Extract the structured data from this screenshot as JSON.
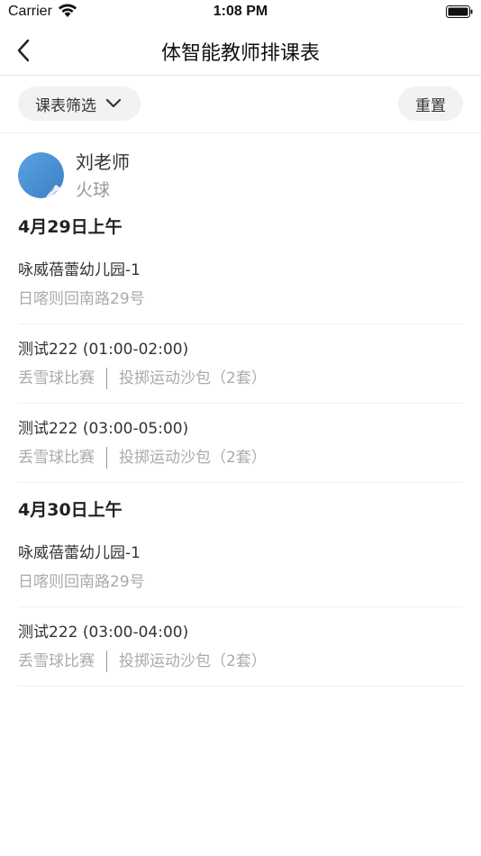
{
  "status_bar": {
    "carrier": "Carrier",
    "time": "1:08 PM"
  },
  "nav": {
    "title": "体智能教师排课表"
  },
  "filter": {
    "filter_label": "课表筛选",
    "reset_label": "重置"
  },
  "teacher": {
    "name": "刘老师",
    "subject": "火球"
  },
  "days": [
    {
      "heading": "4月29日上午",
      "entries": [
        {
          "title": "咏威蓓蕾幼儿园-1",
          "sub": "日喀则回南路29号"
        },
        {
          "title": "测试222 (01:00-02:00)",
          "sub_left": "丢雪球比赛",
          "sub_right": "投掷运动沙包（2套）"
        },
        {
          "title": "测试222 (03:00-05:00)",
          "sub_left": "丢雪球比赛",
          "sub_right": "投掷运动沙包（2套）"
        }
      ]
    },
    {
      "heading": "4月30日上午",
      "entries": [
        {
          "title": "咏威蓓蕾幼儿园-1",
          "sub": "日喀则回南路29号"
        },
        {
          "title": "测试222 (03:00-04:00)",
          "sub_left": "丢雪球比赛",
          "sub_right": "投掷运动沙包（2套）"
        }
      ]
    }
  ],
  "colors": {
    "avatar": "#4a90d9",
    "muted_text": "#aaaaaa",
    "button_bg": "#f2f2f2"
  },
  "icons": [
    "wifi-icon",
    "battery-icon",
    "back-chevron-icon",
    "chevron-down-icon",
    "avatar-image"
  ]
}
